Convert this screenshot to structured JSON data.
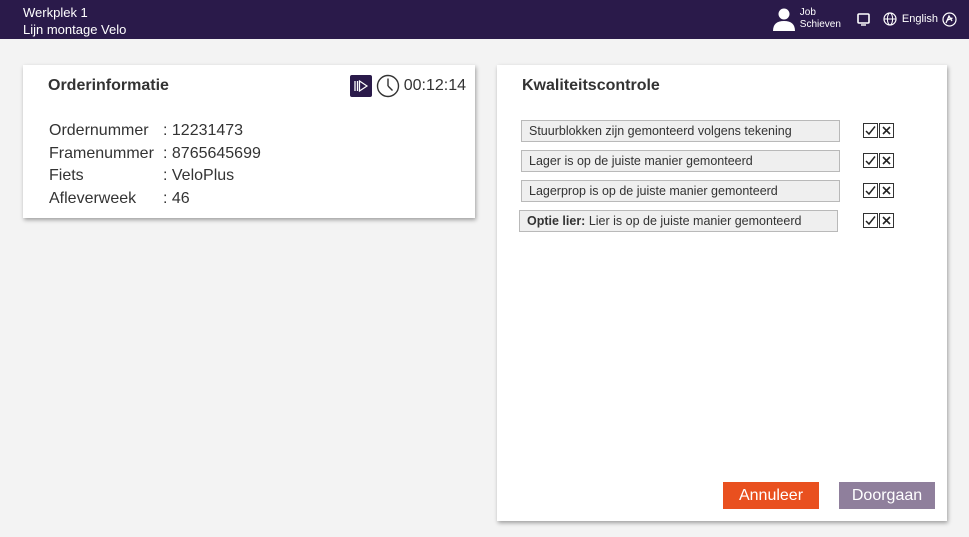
{
  "header": {
    "workstation": "Werkplek 1",
    "line": "Lijn montage Velo",
    "user_first": "Job",
    "user_last": "Schieven",
    "language": "English"
  },
  "order": {
    "title": "Orderinformatie",
    "timer": "00:12:14",
    "fields": [
      {
        "label": "Ordernummer",
        "value": ": 12231473"
      },
      {
        "label": "Framenummer",
        "value": ": 8765645699"
      },
      {
        "label": "Fiets",
        "value": ": VeloPlus"
      },
      {
        "label": "Afleverweek",
        "value": ": 46"
      }
    ]
  },
  "quality": {
    "title": "Kwaliteitscontrole",
    "checks": [
      {
        "prefix": "",
        "text": "Stuurblokken zijn gemonteerd volgens tekening"
      },
      {
        "prefix": "",
        "text": "Lager is op de juiste manier gemonteerd"
      },
      {
        "prefix": "",
        "text": "Lagerprop is op de juiste manier gemonteerd"
      },
      {
        "prefix": "Optie lier:",
        "text": " Lier is op de juiste manier gemonteerd"
      }
    ],
    "cancel_label": "Annuleer",
    "continue_label": "Doorgaan"
  },
  "colors": {
    "header_bg": "#2a1a4a",
    "cancel": "#e9501f",
    "continue": "#8f7f9c"
  }
}
